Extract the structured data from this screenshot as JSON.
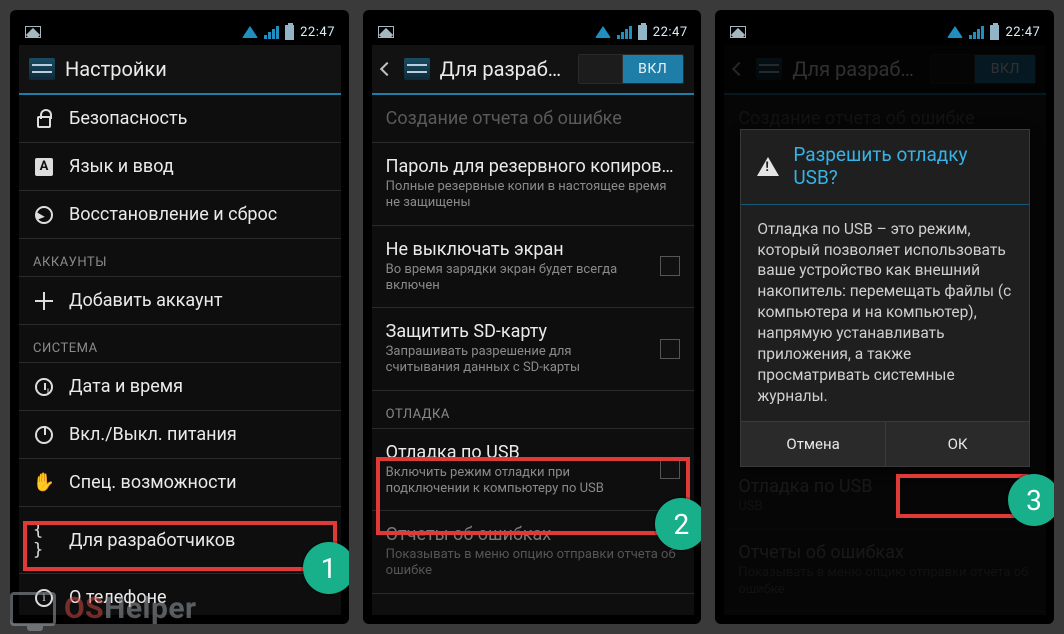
{
  "status": {
    "time": "22:47"
  },
  "screen1": {
    "header": {
      "title": "Настройки"
    },
    "rows": {
      "security": "Безопасность",
      "language": "Язык и ввод",
      "backup": "Восстановление и сброс",
      "cat_accounts": "АККАУНТЫ",
      "add_account": "Добавить аккаунт",
      "cat_system": "СИСТЕМА",
      "datetime": "Дата и время",
      "power": "Вкл./Выкл. питания",
      "accessibility": "Спец. возможности",
      "developer": "Для разработчиков",
      "about": "О телефоне"
    },
    "badge": "1"
  },
  "screen2": {
    "header": {
      "title": "Для разраб…",
      "toggle_on": "ВКЛ"
    },
    "rows": {
      "bugreport": "Создание отчета об ошибке",
      "backup_pw_t": "Пароль для резервного копирования",
      "backup_pw_s": "Полные резервные копии в настоящее время не защищены",
      "stayawake_t": "Не выключать экран",
      "stayawake_s": "Во время зарядки экран будет всегда включен",
      "sdprotect_t": "Защитить SD-карту",
      "sdprotect_s": "Запрашивать разрешение для считывания данных с SD-карты",
      "cat_debug": "ОТЛАДКА",
      "usb_t": "Отладка по USB",
      "usb_s": "Включить режим отладки при подключении к компьютеру по USB",
      "bugrep2_t": "Отчеты об ошибках",
      "bugrep2_s": "Показывать в меню опцию отправки отчета об ошибке"
    },
    "badge": "2"
  },
  "screen3": {
    "header": {
      "title": "Для разраб…",
      "toggle_on": "ВКЛ"
    },
    "rows": {
      "bugreport": "Создание отчета об ошибке",
      "usb_t": "Отладка по USB",
      "usb_s": "USB",
      "bugrep2_t": "Отчеты об ошибках",
      "bugrep2_s": "Показывать в меню опцию отправки отчета об ошибке"
    },
    "dialog": {
      "title": "Разрешить отладку USB?",
      "body": "Отладка по USB – это режим, который позволяет использовать ваше устройство как внешний накопитель: перемещать файлы (с компьютера и на компьютер), напрямую устанавливать приложения, а также просматривать системные журналы.",
      "cancel": "Отмена",
      "ok": "ОК"
    },
    "badge": "3"
  },
  "watermark": {
    "brand1": "OS",
    "brand2": "Helper"
  }
}
